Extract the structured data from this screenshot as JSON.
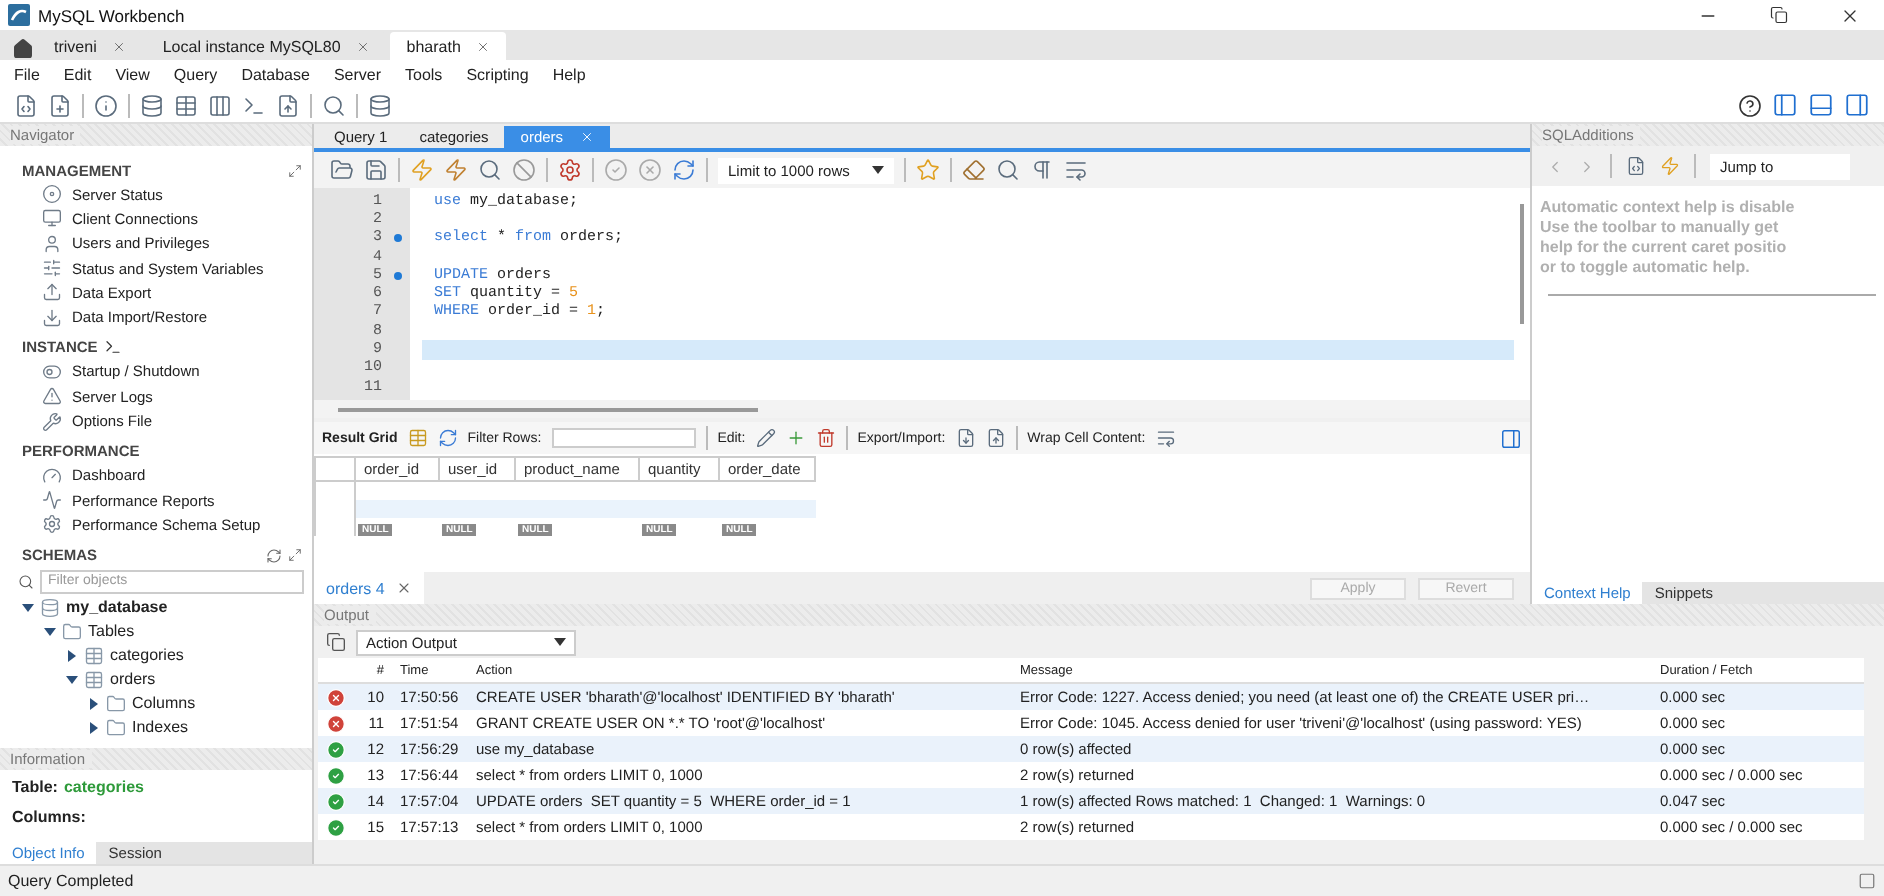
{
  "window": {
    "title": "MySQL Workbench"
  },
  "connection_tabs": [
    {
      "label": "triveni",
      "selected": false
    },
    {
      "label": "Local instance MySQL80",
      "selected": false
    },
    {
      "label": "bharath",
      "selected": true
    }
  ],
  "menu": [
    "File",
    "Edit",
    "View",
    "Query",
    "Database",
    "Server",
    "Tools",
    "Scripting",
    "Help"
  ],
  "navigator": {
    "title": "Navigator",
    "sections": [
      {
        "title": "MANAGEMENT",
        "items": [
          "Server Status",
          "Client Connections",
          "Users and Privileges",
          "Status and System Variables",
          "Data Export",
          "Data Import/Restore"
        ]
      },
      {
        "title": "INSTANCE",
        "items": [
          "Startup / Shutdown",
          "Server Logs",
          "Options File"
        ]
      },
      {
        "title": "PERFORMANCE",
        "items": [
          "Dashboard",
          "Performance Reports",
          "Performance Schema Setup"
        ]
      }
    ],
    "schemas": {
      "title": "SCHEMAS",
      "placeholder": "Filter objects",
      "tree": [
        {
          "label": "my_database",
          "expanded": true,
          "children": [
            {
              "label": "Tables",
              "expanded": true,
              "children": [
                {
                  "label": "categories",
                  "expanded": false
                },
                {
                  "label": "orders",
                  "expanded": true,
                  "children": [
                    {
                      "label": "Columns",
                      "expanded": false
                    },
                    {
                      "label": "Indexes",
                      "expanded": false
                    }
                  ]
                }
              ]
            }
          ]
        }
      ]
    },
    "information": {
      "title": "Information",
      "table_label": "Table:",
      "table_name": "categories",
      "columns_label": "Columns:"
    },
    "tabs": [
      {
        "label": "Object Info",
        "selected": true
      },
      {
        "label": "Session",
        "selected": false
      }
    ]
  },
  "editor_tabs": [
    {
      "label": "Query 1",
      "selected": false
    },
    {
      "label": "categories",
      "selected": false
    },
    {
      "label": "orders",
      "selected": true
    }
  ],
  "limit": "Limit to 1000 rows",
  "editor_lines": [
    {
      "number": "1",
      "marker": false,
      "current": false,
      "tokens": [
        {
          "kind": "keyword",
          "text": "use"
        },
        {
          "kind": "plain",
          "text": " my_database;"
        }
      ]
    },
    {
      "number": "2",
      "marker": false,
      "current": false
    },
    {
      "number": "3",
      "marker": true,
      "current": false,
      "tokens": [
        {
          "kind": "keyword",
          "text": "select"
        },
        {
          "kind": "plain",
          "text": " * "
        },
        {
          "kind": "keyword",
          "text": "from"
        },
        {
          "kind": "plain",
          "text": " orders;"
        }
      ]
    },
    {
      "number": "4",
      "marker": false,
      "current": false
    },
    {
      "number": "5",
      "marker": true,
      "current": false,
      "tokens": [
        {
          "kind": "keyword",
          "text": "UPDATE"
        },
        {
          "kind": "plain",
          "text": " orders"
        }
      ]
    },
    {
      "number": "6",
      "marker": false,
      "current": false,
      "tokens": [
        {
          "kind": "keyword",
          "text": "SET"
        },
        {
          "kind": "plain",
          "text": " quantity = "
        },
        {
          "kind": "number",
          "text": "5"
        }
      ]
    },
    {
      "number": "7",
      "marker": false,
      "current": false,
      "tokens": [
        {
          "kind": "keyword",
          "text": "WHERE"
        },
        {
          "kind": "plain",
          "text": " order_id = "
        },
        {
          "kind": "number",
          "text": "1"
        },
        {
          "kind": "plain",
          "text": ";"
        }
      ]
    },
    {
      "number": "8",
      "marker": false,
      "current": false
    },
    {
      "number": "9",
      "marker": false,
      "current": true
    },
    {
      "number": "10",
      "marker": false,
      "current": false
    },
    {
      "number": "11",
      "marker": false,
      "current": false
    }
  ],
  "result_toolbar": {
    "grid_label": "Result Grid",
    "filter_label": "Filter Rows:",
    "edit_label": "Edit:",
    "export_label": "Export/Import:",
    "wrap_label": "Wrap Cell Content:"
  },
  "result_grid": {
    "columns": [
      "order_id",
      "user_id",
      "product_name",
      "quantity",
      "order_date"
    ],
    "rows": [
      {
        "selected": false
      },
      {
        "selected": true
      },
      {
        "selected": false,
        "cells": [
          "NULL",
          "NULL",
          "NULL",
          "NULL",
          "NULL"
        ]
      }
    ]
  },
  "result_tabs": [
    {
      "label": "orders 4",
      "selected": true
    }
  ],
  "result_buttons": [
    {
      "label": "Apply",
      "disabled": true
    },
    {
      "label": "Revert",
      "disabled": true
    }
  ],
  "sql_additions": {
    "title": "SQLAdditions",
    "jump_to": "Jump to",
    "help_lines": [
      "Automatic context help is disable",
      "Use the toolbar to manually get",
      "help for the current caret positio",
      "or to toggle automatic help."
    ],
    "tabs": [
      {
        "label": "Context Help",
        "selected": true
      },
      {
        "label": "Snippets",
        "selected": false
      }
    ]
  },
  "output": {
    "title": "Output",
    "mode": "Action Output",
    "columns": [
      "#",
      "Time",
      "Action",
      "Message",
      "Duration / Fetch"
    ],
    "rows": [
      {
        "kind": "error",
        "number": "10",
        "time": "17:50:56",
        "action": "CREATE USER 'bharath'@'localhost' IDENTIFIED BY 'bharath'",
        "message": "Error Code: 1227. Access denied; you need (at least one of) the CREATE USER pri…",
        "duration": "0.000 sec"
      },
      {
        "kind": "error",
        "number": "11",
        "time": "17:51:54",
        "action": "GRANT CREATE USER ON *.* TO 'root'@'localhost'",
        "message": "Error Code: 1045. Access denied for user 'triveni'@'localhost' (using password: YES)",
        "duration": "0.000 sec"
      },
      {
        "kind": "success",
        "number": "12",
        "time": "17:56:29",
        "action": "use my_database",
        "message": "0 row(s) affected",
        "duration": "0.000 sec"
      },
      {
        "kind": "success",
        "number": "13",
        "time": "17:56:44",
        "action": "select * from orders LIMIT 0, 1000",
        "message": "2 row(s) returned",
        "duration": "0.000 sec / 0.000 sec"
      },
      {
        "kind": "success",
        "number": "14",
        "time": "17:57:04",
        "action": "UPDATE orders  SET quantity = 5  WHERE order_id = 1",
        "message": "1 row(s) affected Rows matched: 1  Changed: 1  Warnings: 0",
        "duration": "0.047 sec"
      },
      {
        "kind": "success",
        "number": "15",
        "time": "17:57:13",
        "action": "select * from orders LIMIT 0, 1000",
        "message": "2 row(s) returned",
        "duration": "0.000 sec / 0.000 sec"
      }
    ]
  },
  "status_bar": "Query Completed"
}
